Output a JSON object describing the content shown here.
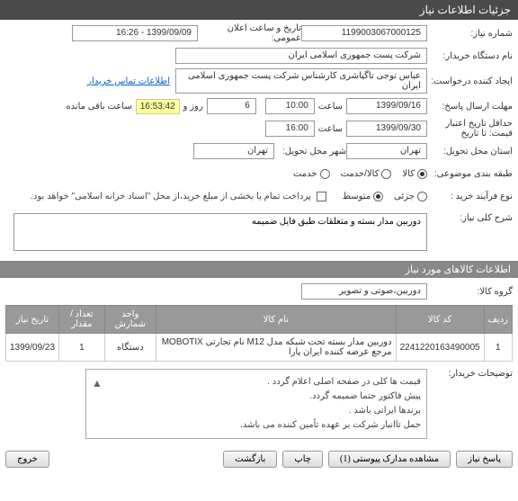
{
  "header": {
    "title": "جزئیات اطلاعات نیاز"
  },
  "fields": {
    "need_number_label": "شماره نیاز:",
    "need_number": "1199003067000125",
    "announce_label": "تاریخ و ساعت اعلان عمومی:",
    "announce_value": "1399/09/09 - 16:26",
    "buyer_org_label": "نام دستگاه خریدار:",
    "buyer_org": "شرکت پست جمهوری اسلامی ایران",
    "creator_label": "ایجاد کننده درخواست:",
    "creator": "عباس توجی تاگیاشری کارشناس شرکت پست جمهوری اسلامی ایران",
    "contact_link": "اطلاعات تماس خریدار",
    "deadline_label": "مهلت ارسال پاسخ:",
    "deadline_sub": "تا تاریخ",
    "deadline_date": "1399/09/16",
    "deadline_hour_label": "ساعت",
    "deadline_hour": "10:00",
    "remain1": "6",
    "remain1_label": "روز و",
    "remain2": "16:53:42",
    "remain2_label": "ساعت باقی مانده",
    "validity_label": "حداقل تاریخ اعتبار قیمت: تا تاریخ",
    "validity_date": "1399/09/30",
    "validity_hour_label": "ساعت",
    "validity_hour": "16:00",
    "delivery_state_label": "استان محل تحویل:",
    "delivery_state": "تهران",
    "delivery_city_label": "شهر محل تحویل:",
    "delivery_city": "تهران",
    "category_label": "طبقه بندی موضوعی:",
    "cat_goods": "کالا",
    "cat_service": "کالا/خدمت",
    "cat_service2": "خدمت",
    "process_label": "نوع فرآیند خرید :",
    "proc_small": "جزئی",
    "proc_medium": "متوسط",
    "partial_label": "پرداخت تمام یا بخشی از مبلغ خرید،از محل \"اسناد خزانه اسلامی\" خواهد بود.",
    "desc_label": "شرح کلی نیاز:",
    "desc_value": "دوربین مدار بسته و متعلقات طبق فایل ضمیمه",
    "items_header": "اطلاعات کالاهای مورد نیاز",
    "group_label": "گروه کالا:",
    "group_value": "دوربین،صوتی و تصویر"
  },
  "table": {
    "headers": {
      "row": "ردیف",
      "code": "کد کالا",
      "name": "نام کالا",
      "unit": "واحد شمارش",
      "qty": "تعداد / مقدار",
      "date": "تاریخ نیاز"
    },
    "rows": [
      {
        "row": "1",
        "code": "2241220163490005",
        "name": "دوربین مدار بسته تحت شبکه مدل M12 نام تجارتی MOBOTIX مرجع عرضه کننده ایران پارا",
        "unit": "دستگاه",
        "qty": "1",
        "date": "1399/09/23"
      }
    ]
  },
  "notes": {
    "label": "توضیحات خریدار:",
    "line1": "قیمت ها کلی در صفحه اصلی اعلام گردد .",
    "line2": "پیش فاکتور حتما ضمیمه گردد.",
    "line3": "برندها ایرانی باشد .",
    "line4": "حمل تاانبار شرکت بر عهده تأمین کننده می باشد."
  },
  "buttons": {
    "reply": "پاسخ نیاز",
    "attachments": "مشاهده مدارک پیوستی (1)",
    "print": "چاپ",
    "back": "بازگشت",
    "exit": "خروج"
  }
}
